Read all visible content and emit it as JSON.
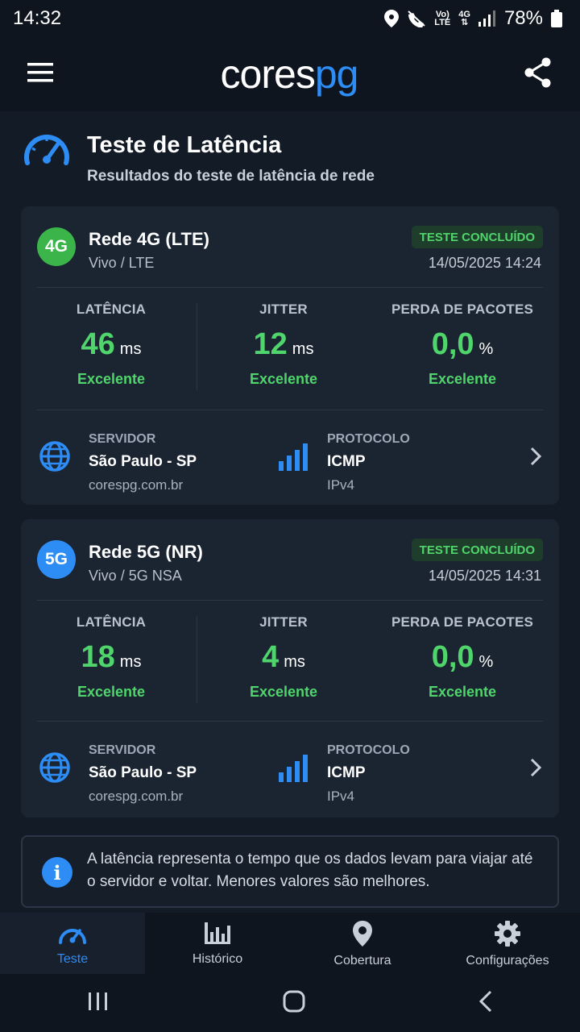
{
  "status_bar": {
    "time": "14:32",
    "battery": "78%",
    "network_volte_top": "Vo)",
    "network_volte_bottom": "LTE",
    "network_gen": "4G"
  },
  "app_bar": {
    "logo_part1": "cores",
    "logo_part2": "pg",
    "menu_icon": "hamburger-menu-icon",
    "share_icon": "share-icon"
  },
  "page": {
    "title": "Teste de Latência",
    "subtitle": "Resultados do teste de latência de rede"
  },
  "cards": [
    {
      "badge": "4G",
      "badge_color": "#3bb54a",
      "name": "Rede 4G (LTE)",
      "operator": "Vivo / LTE",
      "status": "TESTE CONCLUÍDO",
      "date": "14/05/2025 14:24",
      "metrics": [
        {
          "label": "LATÊNCIA",
          "value": "46",
          "unit": "ms",
          "rating": "Excelente"
        },
        {
          "label": "JITTER",
          "value": "12",
          "unit": "ms",
          "rating": "Excelente"
        },
        {
          "label": "PERDA DE PACOTES",
          "value": "0,0",
          "unit": "%",
          "rating": "Excelente"
        }
      ],
      "server_label": "SERVIDOR",
      "server_name": "São Paulo - SP",
      "server_host": "corespg.com.br",
      "protocol_label": "PROTOCOLO",
      "protocol_name": "ICMP",
      "protocol_version": "IPv4"
    },
    {
      "badge": "5G",
      "badge_color": "#2d8df5",
      "name": "Rede 5G (NR)",
      "operator": "Vivo / 5G NSA",
      "status": "TESTE CONCLUÍDO",
      "date": "14/05/2025 14:31",
      "metrics": [
        {
          "label": "LATÊNCIA",
          "value": "18",
          "unit": "ms",
          "rating": "Excelente"
        },
        {
          "label": "JITTER",
          "value": "4",
          "unit": "ms",
          "rating": "Excelente"
        },
        {
          "label": "PERDA DE PACOTES",
          "value": "0,0",
          "unit": "%",
          "rating": "Excelente"
        }
      ],
      "server_label": "SERVIDOR",
      "server_name": "São Paulo - SP",
      "server_host": "corespg.com.br",
      "protocol_label": "PROTOCOLO",
      "protocol_name": "ICMP",
      "protocol_version": "IPv4"
    }
  ],
  "info": {
    "text": "A latência representa o tempo que os dados levam para viajar até o servidor e voltar. Menores valores são melhores."
  },
  "bottom_nav": [
    {
      "label": "Teste",
      "icon": "speedometer-icon",
      "active": true
    },
    {
      "label": "Histórico",
      "icon": "bar-chart-icon",
      "active": false
    },
    {
      "label": "Cobertura",
      "icon": "location-pin-icon",
      "active": false
    },
    {
      "label": "Configurações",
      "icon": "gear-icon",
      "active": false
    }
  ],
  "colors": {
    "accent": "#2d8df5",
    "success": "#4fd56b",
    "background": "#131b27",
    "card": "#1b2431"
  }
}
